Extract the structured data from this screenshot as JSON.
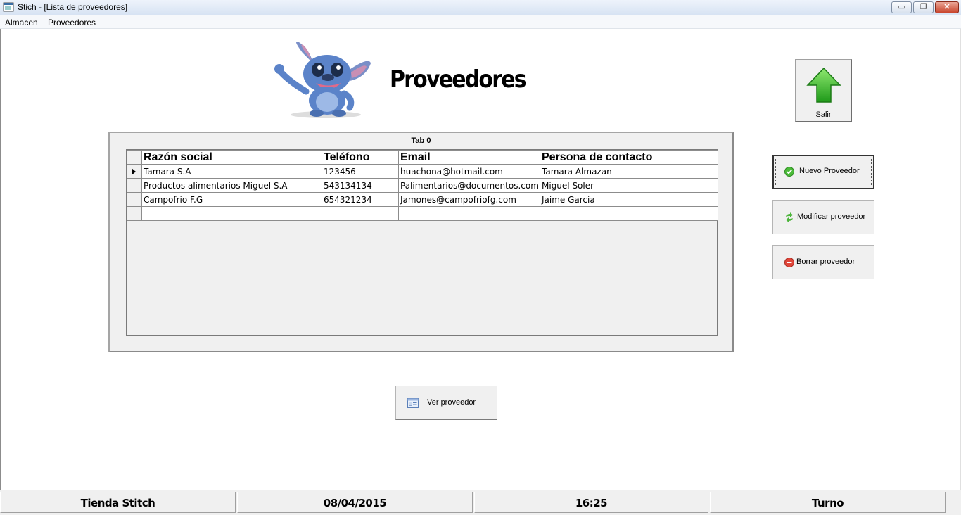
{
  "window": {
    "title": "Stich - [Lista de proveedores]",
    "buttons": {
      "minimize": "▭",
      "restore": "❐",
      "close": "✕"
    }
  },
  "menu": {
    "items": [
      "Almacen",
      "Proveedores"
    ]
  },
  "header": {
    "title": "Proveedores"
  },
  "exit_button": {
    "label": "Salir",
    "icon": "green-up-arrow-icon"
  },
  "tab": {
    "label": "Tab 0"
  },
  "grid": {
    "columns": [
      "Razón social",
      "Teléfono",
      "Email",
      "Persona de contacto"
    ],
    "rows": [
      {
        "razon": "Tamara S.A",
        "telefono": "123456",
        "email": "huachona@hotmail.com",
        "contacto": "Tamara Almazan"
      },
      {
        "razon": "Productos alimentarios Miguel S.A",
        "telefono": "543134134",
        "email": "Palimentarios@documentos.com",
        "contacto": "Miguel Soler"
      },
      {
        "razon": "Campofrio F.G",
        "telefono": "654321234",
        "email": "Jamones@campofriofg.com",
        "contacto": "Jaime Garcia"
      }
    ],
    "current_row": 0
  },
  "actions": {
    "new": {
      "label": "Nuevo Proveedor",
      "icon": "green-check-icon"
    },
    "edit": {
      "label": "Modificar proveedor",
      "icon": "refresh-arrows-icon"
    },
    "delete": {
      "label": "Borrar proveedor",
      "icon": "red-minus-icon"
    },
    "view": {
      "label": "Ver proveedor",
      "icon": "card-view-icon"
    }
  },
  "status": {
    "store": "Tienda Stitch",
    "date": "08/04/2015",
    "time": "16:25",
    "shift": "Turno"
  },
  "colors": {
    "accent_green": "#3fbf2e",
    "delete_red": "#e0463a",
    "panel_gray": "#f0f0f0"
  }
}
